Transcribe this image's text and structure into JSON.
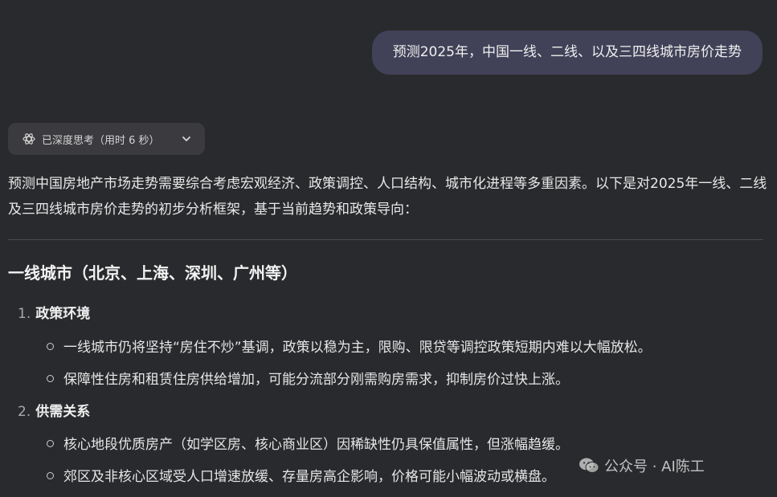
{
  "user_message": "预测2025年，中国一线、二线、以及三四线城市房价走势",
  "thinking": {
    "label": "已深度思考（用时 6 秒）",
    "icon": "atom-icon",
    "expand_icon": "chevron-down-icon"
  },
  "intro": "预测中国房地产市场走势需要综合考虑宏观经济、政策调控、人口结构、城市化进程等多重因素。以下是对2025年一线、二线及三四线城市房价走势的初步分析框架，基于当前趋势和政策导向：",
  "section": {
    "title": "一线城市（北京、上海、深圳、广州等）",
    "items": [
      {
        "num": "1.",
        "title": "政策环境",
        "bullets": [
          "一线城市仍将坚持“房住不炒”基调，政策以稳为主，限购、限贷等调控政策短期内难以大幅放松。",
          "保障性住房和租赁住房供给增加，可能分流部分刚需购房需求，抑制房价过快上涨。"
        ]
      },
      {
        "num": "2.",
        "title": "供需关系",
        "bullets": [
          "核心地段优质房产（如学区房、核心商业区）因稀缺性仍具保值属性，但涨幅趋缓。",
          "郊区及非核心区域受人口增速放缓、存量房高企影响，价格可能小幅波动或横盘。"
        ]
      }
    ]
  },
  "watermark": {
    "text": "公众号 · AI陈工",
    "icon": "wechat-icon"
  }
}
